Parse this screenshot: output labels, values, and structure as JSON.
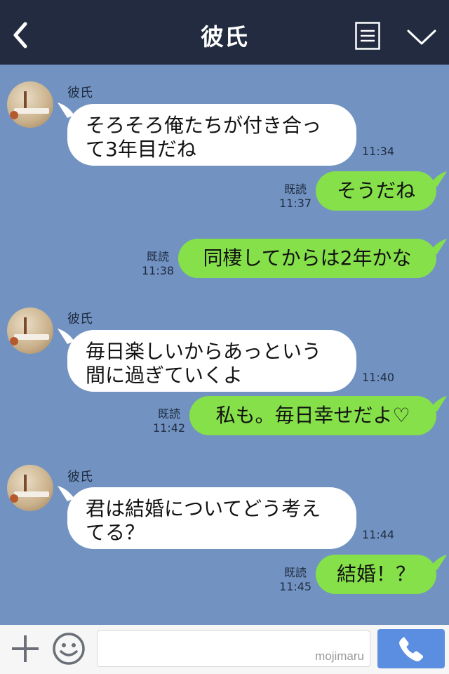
{
  "header": {
    "title": "彼氏",
    "back_icon": "chevron-left-icon",
    "menu_icon": "list-menu-icon",
    "collapse_icon": "chevron-down-icon"
  },
  "messages": [
    {
      "from": "partner",
      "sender": "彼氏",
      "lines": [
        "そろそろ俺たちが付き合っ",
        "て3年目だね"
      ],
      "time": "11:34"
    },
    {
      "from": "me",
      "read": "既読",
      "time": "11:37",
      "text": "そうだね"
    },
    {
      "from": "me",
      "read": "既読",
      "time": "11:38",
      "text": "同棲してからは2年かな"
    },
    {
      "from": "partner",
      "sender": "彼氏",
      "lines": [
        "毎日楽しいからあっという",
        "間に過ぎていくよ"
      ],
      "time": "11:40"
    },
    {
      "from": "me",
      "read": "既読",
      "time": "11:42",
      "text": "私も。毎日幸せだよ♡"
    },
    {
      "from": "partner",
      "sender": "彼氏",
      "lines": [
        "君は結婚についてどう考え",
        "てる？"
      ],
      "time": "11:44"
    },
    {
      "from": "me",
      "read": "既読",
      "time": "11:45",
      "text": "結婚！？"
    }
  ],
  "footer": {
    "input_placeholder": "",
    "watermark": "mojimaru",
    "plus_icon": "plus-icon",
    "emoji_icon": "smiley-icon",
    "call_icon": "phone-icon"
  },
  "colors": {
    "header_bg": "#232b41",
    "chat_bg": "#7293c2",
    "my_bubble": "#86e04a",
    "partner_bubble": "#ffffff",
    "send_button": "#5b8ee0"
  }
}
